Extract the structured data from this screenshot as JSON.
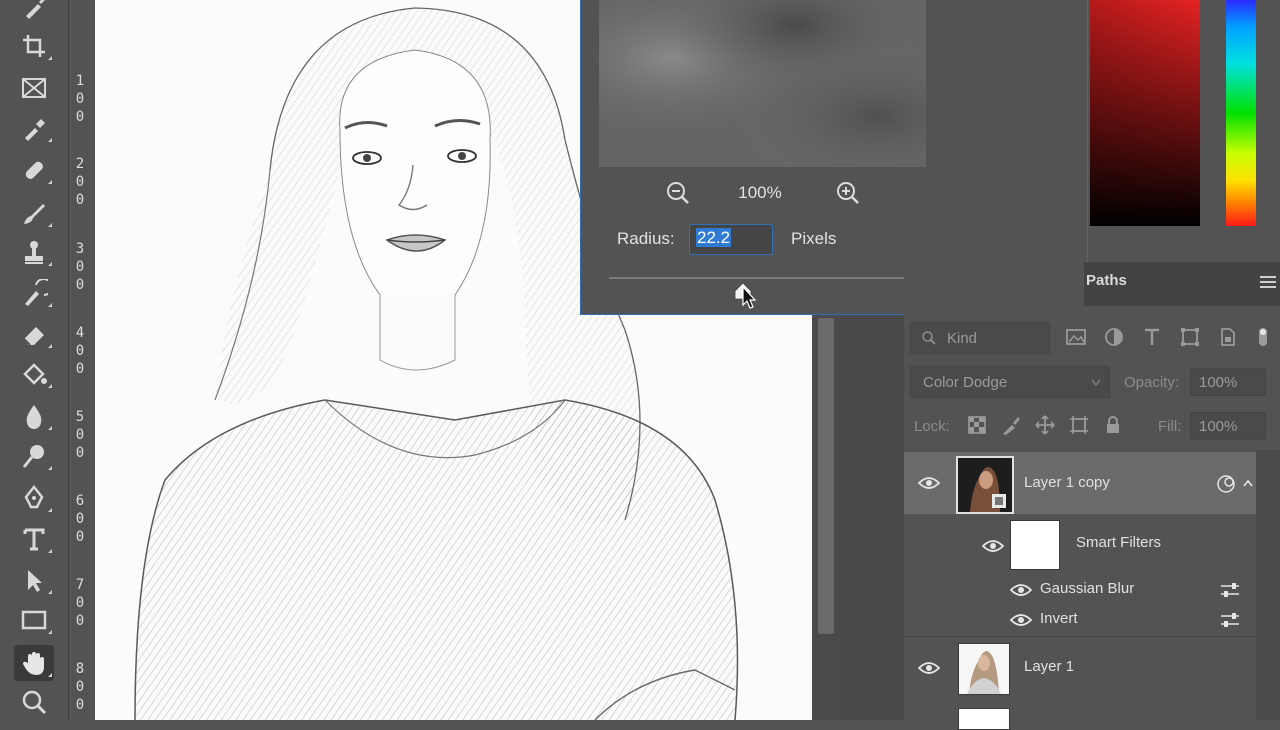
{
  "toolbar": {
    "tools": [
      {
        "icon": "brush-tool-icon"
      },
      {
        "icon": "crop-tool-icon"
      },
      {
        "icon": "frame-tool-icon"
      },
      {
        "icon": "eyedropper-tool-icon"
      },
      {
        "icon": "healing-brush-tool-icon"
      },
      {
        "icon": "brush-tool-icon"
      },
      {
        "icon": "clone-stamp-tool-icon"
      },
      {
        "icon": "history-brush-tool-icon"
      },
      {
        "icon": "eraser-tool-icon"
      },
      {
        "icon": "paint-bucket-tool-icon"
      },
      {
        "icon": "blur-tool-icon"
      },
      {
        "icon": "dodge-tool-icon"
      },
      {
        "icon": "pen-tool-icon"
      },
      {
        "icon": "type-tool-icon"
      },
      {
        "icon": "path-selection-tool-icon"
      },
      {
        "icon": "rectangle-tool-icon"
      },
      {
        "icon": "hand-tool-icon",
        "active": true
      },
      {
        "icon": "zoom-tool-icon"
      }
    ]
  },
  "ruler": {
    "labels": [
      "100",
      "200",
      "300",
      "400",
      "500",
      "600",
      "700",
      "800"
    ]
  },
  "dialog": {
    "zoom_level": "100%",
    "radius_label": "Radius:",
    "radius_value": "22.2",
    "radius_unit": "Pixels",
    "slider_value_fraction": 0.44
  },
  "layers_panel": {
    "tab_label": "Paths",
    "filter_placeholder": "Kind",
    "blend_mode": "Color Dodge",
    "opacity_label": "Opacity:",
    "opacity_value": "100%",
    "lock_label": "Lock:",
    "fill_label": "Fill:",
    "fill_value": "100%",
    "layers": [
      {
        "name": "Layer 1 copy",
        "selected": true,
        "visible": true
      },
      {
        "name": "Smart Filters",
        "visible": true
      },
      {
        "name": "Gaussian Blur",
        "visible": true
      },
      {
        "name": "Invert",
        "visible": true
      },
      {
        "name": "Layer 1",
        "visible": true
      }
    ]
  },
  "colors": {
    "dialog_border": "#2f6fb5",
    "selection": "#2f7ad3",
    "panel_bg": "#535353"
  }
}
